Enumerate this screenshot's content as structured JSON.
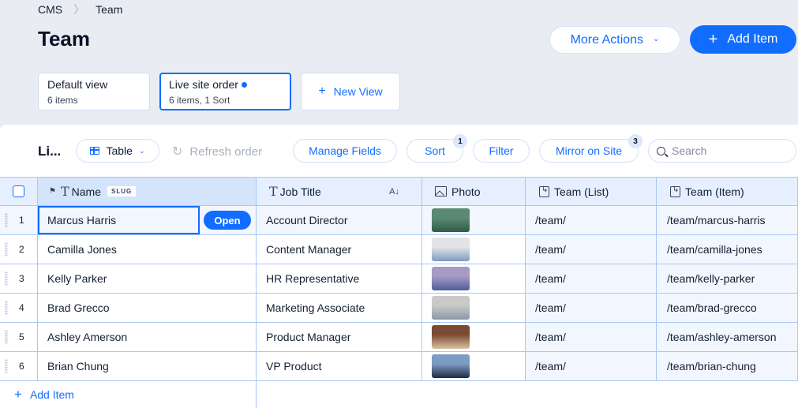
{
  "breadcrumb": {
    "root": "CMS",
    "current": "Team"
  },
  "header": {
    "title": "Team",
    "more_actions": "More Actions",
    "add_item": "Add Item",
    "accent": "#116dff"
  },
  "views": [
    {
      "title": "Default view",
      "subtitle": "6 items",
      "active": false
    },
    {
      "title": "Live site order",
      "subtitle": "6 items, 1 Sort",
      "active": true,
      "unsaved_dot": true
    }
  ],
  "new_view": "New View",
  "toolbar": {
    "title": "Li...",
    "layout": "Table",
    "refresh": "Refresh order",
    "manage_fields": "Manage Fields",
    "sort": "Sort",
    "sort_count": "1",
    "filter": "Filter",
    "mirror": "Mirror on Site",
    "mirror_count": "3",
    "search_placeholder": "Search"
  },
  "table": {
    "columns": [
      {
        "label": "Name",
        "tag": "SLUG",
        "icon": "text-icon"
      },
      {
        "label": "Job Title",
        "icon": "text-icon",
        "sort_indicator": "A↓"
      },
      {
        "label": "Photo",
        "icon": "image-icon"
      },
      {
        "label": "Team (List)",
        "icon": "reference-icon"
      },
      {
        "label": "Team (Item)",
        "icon": "reference-icon"
      }
    ],
    "open_label": "Open",
    "rows": [
      {
        "num": "1",
        "name": "Marcus Harris",
        "job": "Account Director",
        "photo": [
          "#5b8a74",
          "#2f5a45"
        ],
        "list": "/team/",
        "item": "/team/marcus-harris"
      },
      {
        "num": "2",
        "name": "Camilla Jones",
        "job": "Content Manager",
        "photo": [
          "#e4e4e6",
          "#7a9bc2"
        ],
        "list": "/team/",
        "item": "/team/camilla-jones"
      },
      {
        "num": "3",
        "name": "Kelly Parker",
        "job": "HR Representative",
        "photo": [
          "#a79bc4",
          "#4e5d9a"
        ],
        "list": "/team/",
        "item": "/team/kelly-parker"
      },
      {
        "num": "4",
        "name": "Brad Grecco",
        "job": "Marketing Associate",
        "photo": [
          "#c9c9c8",
          "#8a98a3"
        ],
        "list": "/team/",
        "item": "/team/brad-grecco"
      },
      {
        "num": "5",
        "name": "Ashley Amerson",
        "job": "Product Manager",
        "photo": [
          "#7a4a35",
          "#d9c2a2"
        ],
        "list": "/team/",
        "item": "/team/ashley-amerson"
      },
      {
        "num": "6",
        "name": "Brian Chung",
        "job": "VP Product",
        "photo": [
          "#7d9cc4",
          "#1f2a3f"
        ],
        "list": "/team/",
        "item": "/team/brian-chung"
      }
    ],
    "add_item": "Add Item"
  }
}
